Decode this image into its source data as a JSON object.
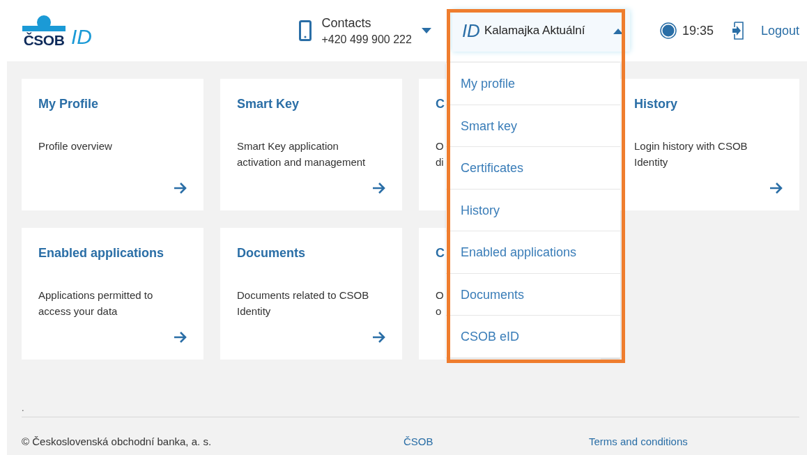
{
  "header": {
    "logo_text": "ČSOB",
    "logo_suffix": "ID",
    "contacts": {
      "title": "Contacts",
      "phone": "+420 499 900 222",
      "expanded": false
    },
    "user": {
      "badge": "ID",
      "name": "Kalamajka Aktuální",
      "expanded": true
    },
    "time": "19:35",
    "logout": "Logout"
  },
  "cards": [
    {
      "title": "My Profile",
      "description": "Profile overview",
      "arrow": true
    },
    {
      "title": "Smart Key",
      "description": "Smart Key application activation and management",
      "arrow": true
    },
    {
      "title": "C",
      "description": "O\ndi"
    },
    {
      "title": "History",
      "description": "Login history with CSOB Identity",
      "arrow": true
    },
    {
      "title": "Enabled applications",
      "description": "Applications permitted to access your data",
      "arrow": true
    },
    {
      "title": "Documents",
      "description": "Documents related to CSOB Identity",
      "arrow": true
    },
    {
      "title": "C",
      "description": "O\no"
    }
  ],
  "user_menu": [
    {
      "label": "My profile",
      "selected": false
    },
    {
      "label": "Smart key",
      "selected": false
    },
    {
      "label": "Certificates",
      "selected": false
    },
    {
      "label": "History",
      "selected": false
    },
    {
      "label": "Enabled applications",
      "selected": false
    },
    {
      "label": "Documents",
      "selected": false
    },
    {
      "label": "CSOB eID",
      "selected": false
    }
  ],
  "footer": {
    "note": ".",
    "copyright": "© Československá obchodní banka, a. s.",
    "links": [
      "ČSOB",
      "Terms and conditions"
    ]
  }
}
